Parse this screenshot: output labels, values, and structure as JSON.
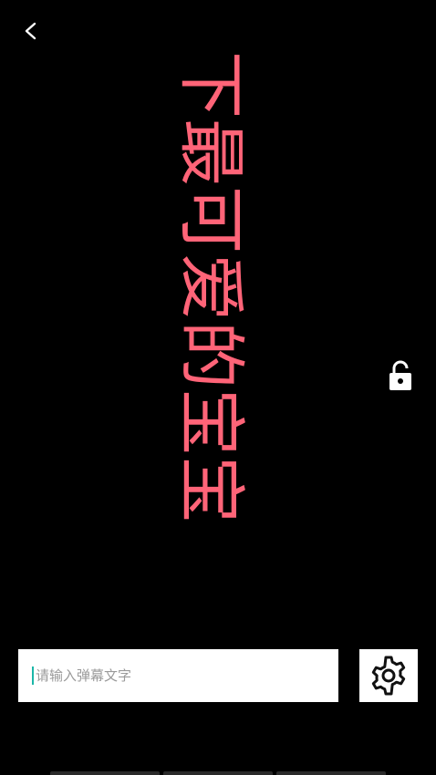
{
  "header": {
    "back_icon": "chevron-left-icon"
  },
  "banner": {
    "text": "下最可爱的宝宝",
    "color": "#ff6478"
  },
  "lock": {
    "icon": "unlock-icon"
  },
  "danmaku_input": {
    "value": "",
    "placeholder": "请输入弹幕文字"
  },
  "settings": {
    "icon": "gear-icon"
  }
}
